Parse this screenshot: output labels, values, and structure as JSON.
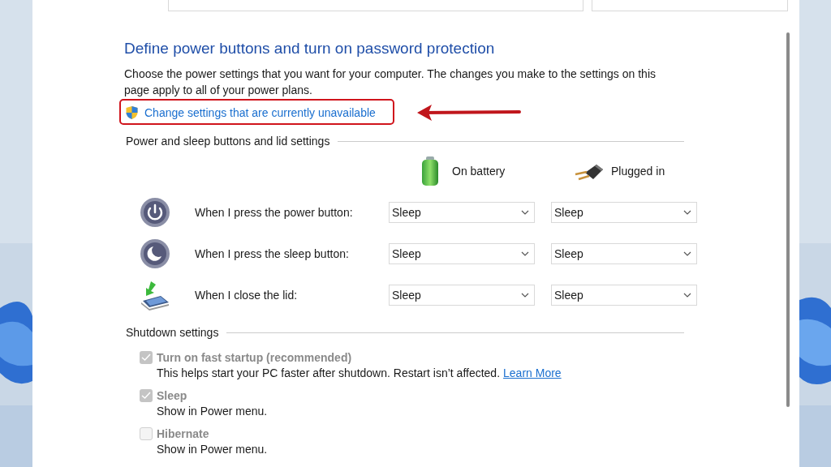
{
  "heading": "Define power buttons and turn on password protection",
  "description": "Choose the power settings that you want for your computer. The changes you make to the settings on this page apply to all of your power plans.",
  "admin_link": {
    "label": "Change settings that are currently unavailable"
  },
  "annotations": [
    {
      "kind": "frame"
    },
    {
      "kind": "arrow"
    }
  ],
  "button_settings": {
    "title": "Power and sleep buttons and lid settings",
    "columns": [
      {
        "kind": "battery",
        "label": "On battery"
      },
      {
        "kind": "plug",
        "label": "Plugged in"
      }
    ],
    "rows": [
      {
        "kind": "power",
        "label": "When I press the power button:",
        "values": [
          "Sleep",
          "Sleep"
        ]
      },
      {
        "kind": "sleep",
        "label": "When I press the sleep button:",
        "values": [
          "Sleep",
          "Sleep"
        ]
      },
      {
        "kind": "lid",
        "label": "When I close the lid:",
        "values": [
          "Sleep",
          "Sleep"
        ]
      }
    ]
  },
  "shutdown_settings": {
    "title": "Shutdown settings",
    "items": [
      {
        "label": "Turn on fast startup (recommended)",
        "checked": true,
        "disabled": true,
        "description": "This helps start your PC faster after shutdown. Restart isn’t affected.",
        "link": "Learn More"
      },
      {
        "label": "Sleep",
        "checked": true,
        "disabled": true,
        "description": "Show in Power menu."
      },
      {
        "label": "Hibernate",
        "checked": false,
        "disabled": true,
        "description": "Show in Power menu."
      }
    ]
  }
}
